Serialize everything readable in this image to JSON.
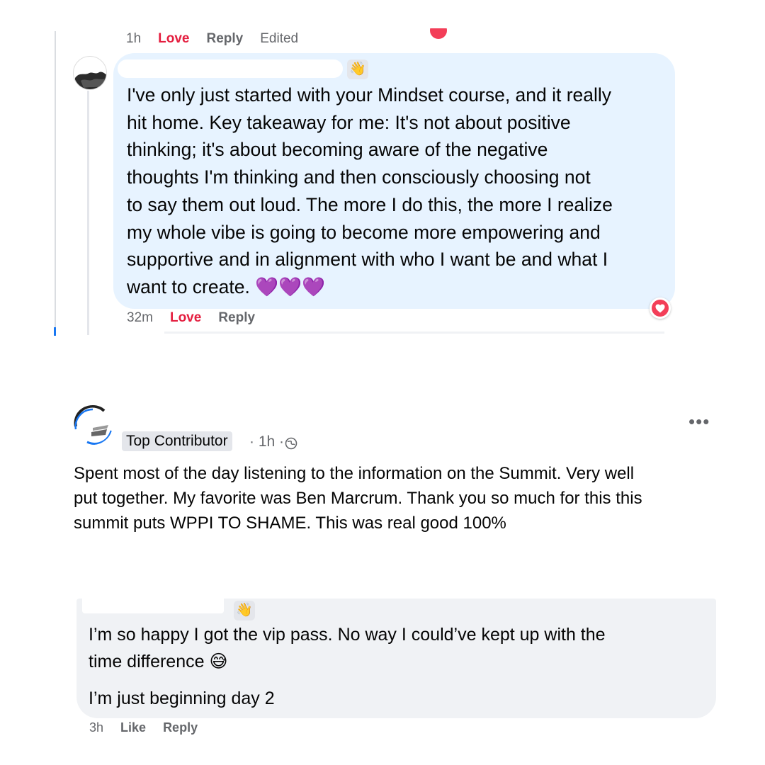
{
  "comment_top_meta": {
    "time": "1h",
    "love": "Love",
    "reply": "Reply",
    "edited": "Edited"
  },
  "reply1": {
    "wave_icon": "waving-hand-icon",
    "text_lines": [
      "I've only just started with your Mindset course, and it really",
      "hit home. Key takeaway for me: It's not about positive",
      "thinking; it's about becoming aware of the negative",
      "thoughts I'm thinking and then consciously choosing not",
      "to say them out loud. The more I do this, the more I realize",
      "my whole vibe is going to become more empowering and",
      "supportive and in alignment with who I want be and what I",
      "want to create. 💜💜💜"
    ],
    "meta": {
      "time": "32m",
      "love": "Love",
      "reply": "Reply"
    },
    "reaction_icon": "love-heart-icon",
    "accent": "#e41e3f"
  },
  "post": {
    "badge": "Top Contributor",
    "time_sep": "· 1h ·",
    "privacy_icon": "public-globe-icon",
    "more_label": "•••",
    "text_lines": [
      "Spent most of the day listening to the information on the Summit.  Very well",
      "put together.   My favorite was Ben Marcrum.  Thank you so much for this this",
      "summit puts WPPI TO SHAME.  This was real good 100%"
    ]
  },
  "comment2": {
    "wave_icon": "waving-hand-icon",
    "text_lines": [
      "I’m so happy I got the vip pass. No way I could’ve kept up with the",
      "time difference 😅"
    ],
    "text_line3": "I’m just beginning day 2",
    "meta": {
      "time": "3h",
      "like": "Like",
      "reply": "Reply"
    }
  }
}
